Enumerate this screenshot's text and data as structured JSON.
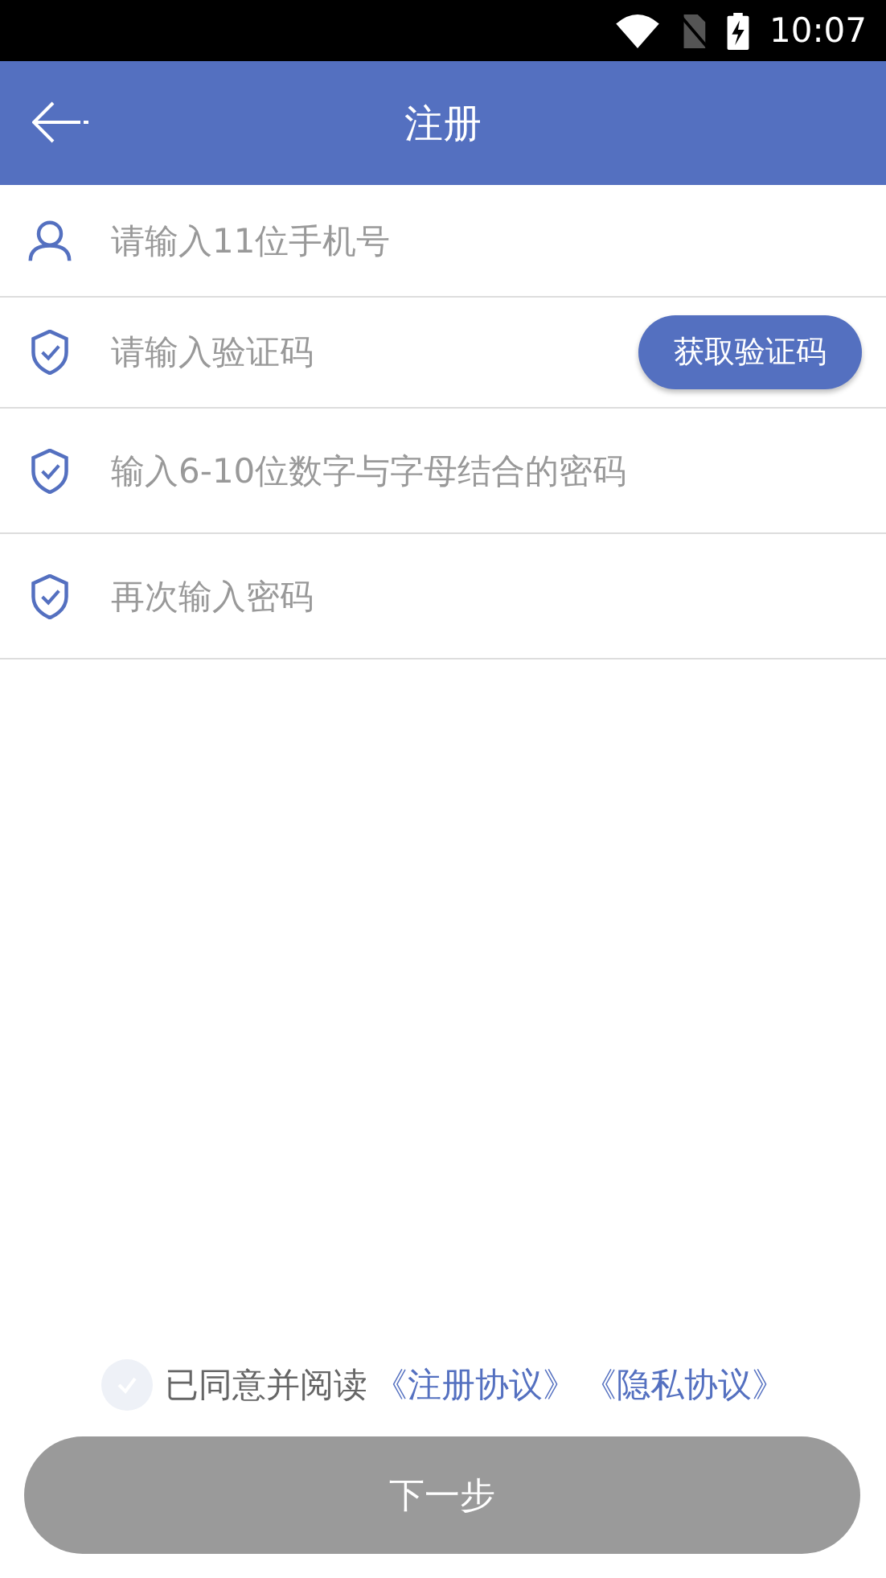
{
  "status_bar": {
    "time": "10:07"
  },
  "header": {
    "title": "注册"
  },
  "fields": [
    {
      "kind": "phone",
      "placeholder": "请输入11位手机号"
    },
    {
      "kind": "code",
      "placeholder": "请输入验证码",
      "button": "获取验证码"
    },
    {
      "kind": "password",
      "placeholder": "输入6-10位数字与字母结合的密码"
    },
    {
      "kind": "password",
      "placeholder": "再次输入密码"
    }
  ],
  "agreement": {
    "checked": false,
    "text": "已同意并阅读",
    "links": [
      "《注册协议》",
      "《隐私协议》"
    ]
  },
  "next_button": {
    "label": "下一步",
    "disabled": true
  }
}
